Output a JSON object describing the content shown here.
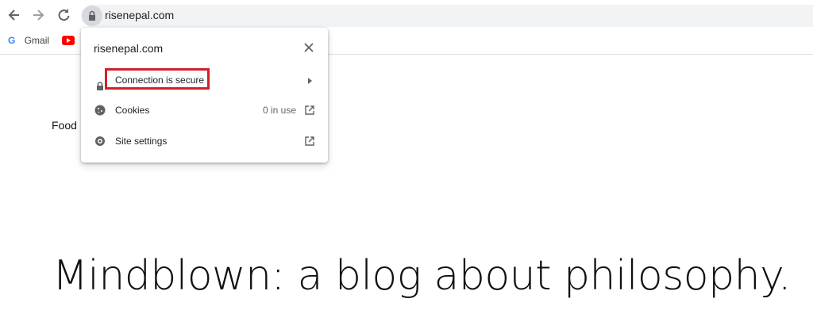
{
  "toolbar": {
    "back_icon": "arrow-left-icon",
    "forward_icon": "arrow-right-icon",
    "reload_icon": "reload-icon",
    "url": "risenepal.com"
  },
  "bookmarks": [
    {
      "label": "Gmail",
      "icon": "google-icon"
    },
    {
      "label": "",
      "icon": "youtube-icon"
    }
  ],
  "page": {
    "food_text": "Food",
    "headline": "Mindblown: a blog about philosophy."
  },
  "site_info_popup": {
    "title": "risenepal.com",
    "rows": [
      {
        "label": "Connection is secure",
        "icon": "lock-icon",
        "action_icon": "chevron-right-icon",
        "highlighted": true
      },
      {
        "label": "Cookies",
        "icon": "cookie-icon",
        "extra": "0 in use",
        "action_icon": "external-link-icon"
      },
      {
        "label": "Site settings",
        "icon": "gear-icon",
        "action_icon": "external-link-icon"
      }
    ]
  },
  "colors": {
    "highlight_border": "#d0202a",
    "omnibox_bg": "#f1f3f4"
  }
}
